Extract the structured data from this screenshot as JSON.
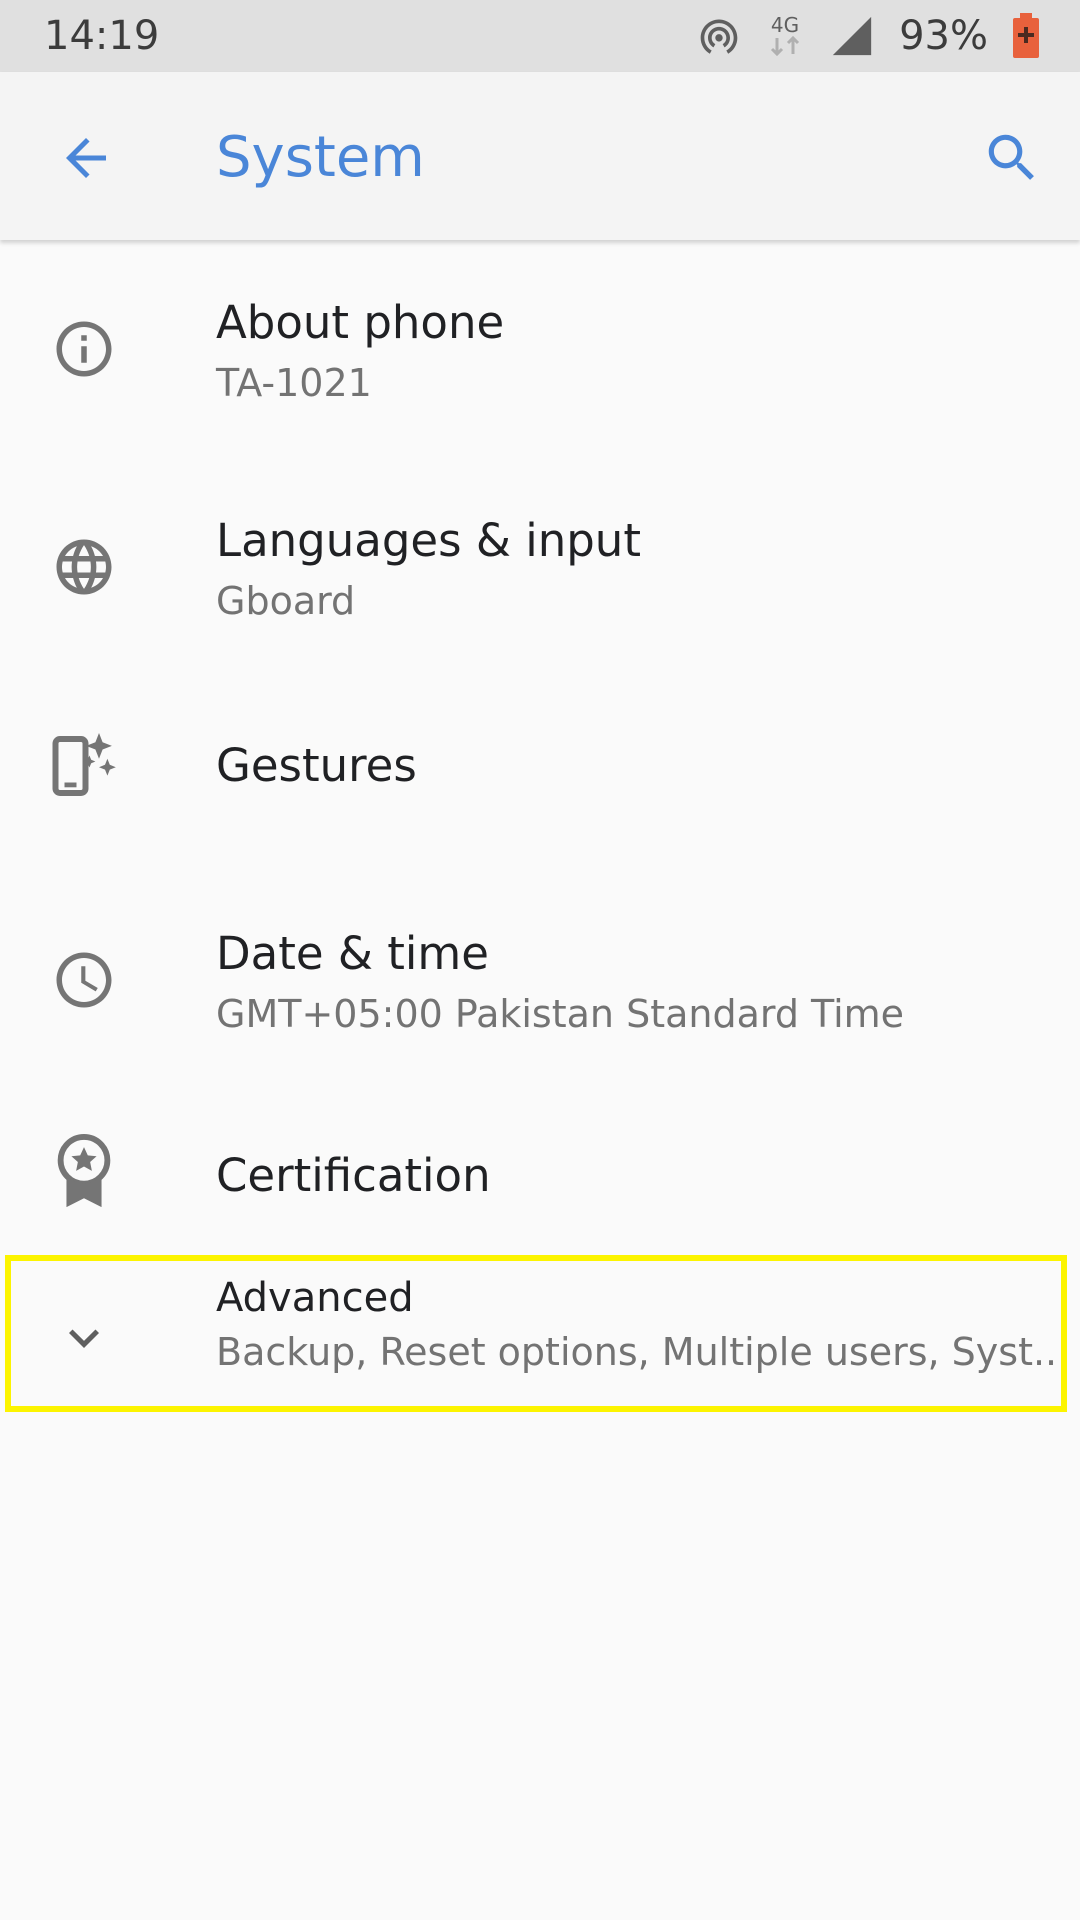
{
  "status_bar": {
    "time": "14:19",
    "battery_percent": "93%",
    "network_type": "4G",
    "icons": [
      "hotspot-icon",
      "mobile-data-4g-icon",
      "signal-icon",
      "battery-charging-icon"
    ]
  },
  "app_bar": {
    "title": "System",
    "back_icon": "arrow-back-icon",
    "search_icon": "search-icon"
  },
  "settings": {
    "about": {
      "title": "About phone",
      "summary": "TA-1021",
      "icon": "info-icon"
    },
    "languages": {
      "title": "Languages & input",
      "summary": "Gboard",
      "icon": "globe-icon"
    },
    "gestures": {
      "title": "Gestures",
      "icon": "gestures-phone-icon"
    },
    "date_time": {
      "title": "Date & time",
      "summary": "GMT+05:00 Pakistan Standard Time",
      "icon": "clock-icon"
    },
    "certification": {
      "title": "Certification",
      "icon": "certification-badge-icon"
    },
    "advanced": {
      "title": "Advanced",
      "summary": "Backup, Reset options, Multiple users, Syst..",
      "icon": "chevron-down-icon"
    }
  },
  "colors": {
    "accent": "#4a86d8",
    "icon_gray": "#757575",
    "status_bar_bg": "#e0e0e0",
    "highlight": "#fcf400",
    "battery_charging": "#e8613c"
  }
}
